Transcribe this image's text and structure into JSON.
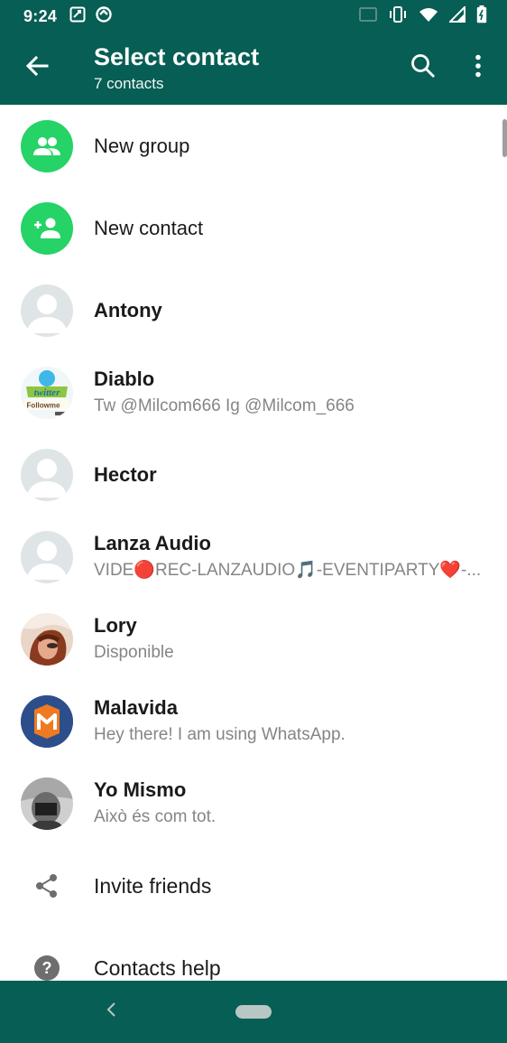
{
  "status_bar": {
    "time": "9:24",
    "icons_left": [
      "gallery-icon",
      "data-saver-icon"
    ],
    "icons_right": [
      "cast-icon",
      "vibrate-icon",
      "wifi-icon",
      "signal-icon",
      "battery-icon"
    ]
  },
  "app_bar": {
    "title": "Select contact",
    "subtitle": "7 contacts",
    "background": "#075e54"
  },
  "actions": [
    {
      "label": "New group",
      "icon": "group-icon"
    },
    {
      "label": "New contact",
      "icon": "add-person-icon"
    }
  ],
  "contacts": [
    {
      "name": "Antony",
      "status": "",
      "avatar": "default-avatar-icon"
    },
    {
      "name": "Diablo",
      "status": "Tw @Milcom666 Ig @Milcom_666",
      "avatar": "twitter-followme-avatar"
    },
    {
      "name": "Hector",
      "status": "",
      "avatar": "default-avatar-icon"
    },
    {
      "name": "Lanza Audio",
      "status": "VIDE🔴REC-LANZAUDIO🎵-EVENTIPARTY❤️-...",
      "avatar": "default-avatar-icon"
    },
    {
      "name": "Lory",
      "status": "Disponible",
      "avatar": "photo-avatar"
    },
    {
      "name": "Malavida",
      "status": "Hey there! I am using WhatsApp.",
      "avatar": "malavida-logo-avatar"
    },
    {
      "name": "Yo Mismo",
      "status": "Això és com tot.",
      "avatar": "photo-avatar"
    }
  ],
  "footer_items": [
    {
      "label": "Invite friends",
      "icon": "share-icon"
    },
    {
      "label": "Contacts help",
      "icon": "help-icon"
    }
  ],
  "colors": {
    "accent": "#25d366",
    "header": "#075e54",
    "secondary_text": "#858585"
  }
}
